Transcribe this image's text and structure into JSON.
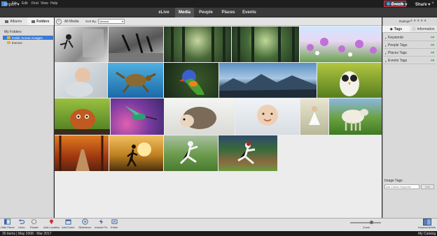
{
  "menu": {
    "items": [
      "File",
      "Edit",
      "Find",
      "View",
      "Help"
    ]
  },
  "search": {
    "label": "Search"
  },
  "modebar": {
    "import": "Import",
    "tabs": [
      "eLive",
      "Media",
      "People",
      "Places",
      "Events"
    ],
    "create": "Create",
    "share": "Share"
  },
  "left_panel": {
    "tabs": [
      "Albums",
      "Folders"
    ],
    "section": "My Folders",
    "folders": [
      "Public Screen Images",
      "themes"
    ]
  },
  "browser": {
    "back": "<",
    "title": "All Media",
    "sort_label": "Sort By:",
    "sort_value": "Newest"
  },
  "right_panel": {
    "ratings_label": "Ratings",
    "stars": "★★★★★",
    "tabs": [
      "Tags",
      "Information"
    ],
    "tag_groups": [
      "Keywords",
      "People Tags",
      "Places Tags",
      "Events Tags"
    ],
    "image_tags_label": "Image Tags",
    "image_tag_placeholder": "Add Custom Keywords",
    "add_button": "Add"
  },
  "toolbar": {
    "tools": [
      "Hide Panel",
      "Undo",
      "Rotate",
      "Add Location",
      "Add Event",
      "Slideshow",
      "Instant Fix",
      "Editor"
    ],
    "zoom_label": "Zoom",
    "keyword_info": "Keywords/Info"
  },
  "status": {
    "count": "30 items  |  May 2008 - Mar 2017",
    "catalog": "My Catalog"
  },
  "colors": {
    "accent": "#3a7bd5",
    "search_border": "#dd3333",
    "plus_green": "#3a9a3a"
  }
}
